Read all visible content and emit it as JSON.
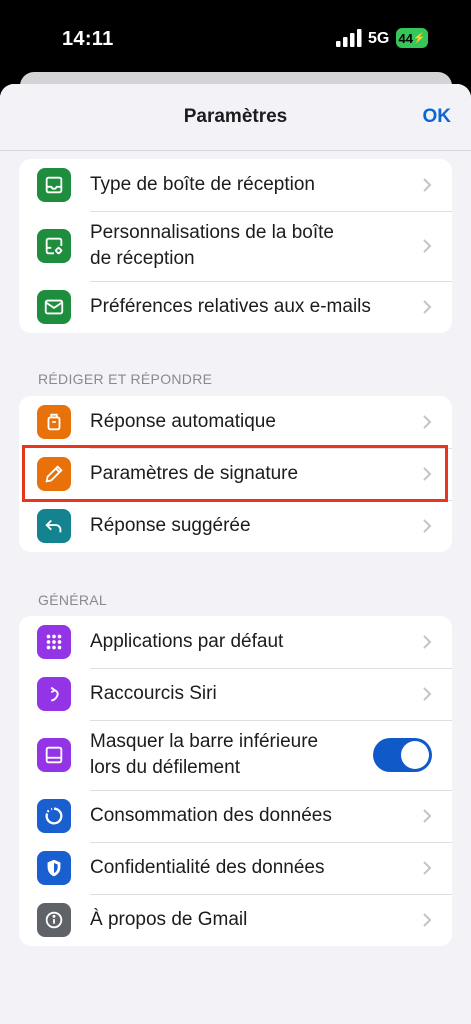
{
  "status": {
    "time": "14:11",
    "network": "5G",
    "battery": "44"
  },
  "header": {
    "title": "Paramètres",
    "ok_label": "OK"
  },
  "inbox_group": {
    "items": [
      {
        "label": "Type de boîte de réception",
        "icon": "inbox-icon",
        "color": "#1e8e3e"
      },
      {
        "label_line1": "Personnalisations de la boîte",
        "label_line2": "de réception",
        "icon": "inbox-settings-icon",
        "color": "#1e8e3e"
      },
      {
        "label": "Préférences relatives aux e-mails",
        "icon": "mail-icon",
        "color": "#1e8e3e"
      }
    ]
  },
  "compose_section": {
    "header": "RÉDIGER ET RÉPONDRE",
    "items": [
      {
        "label": "Réponse automatique",
        "icon": "suitcase-icon",
        "color": "#e8710a"
      },
      {
        "label": "Paramètres de signature",
        "icon": "pen-icon",
        "color": "#e8710a"
      },
      {
        "label": "Réponse suggérée",
        "icon": "reply-icon",
        "color": "#12838f"
      }
    ]
  },
  "general_section": {
    "header": "GÉNÉRAL",
    "items": [
      {
        "label": "Applications par défaut",
        "icon": "apps-grid-icon",
        "color": "#9334e6"
      },
      {
        "label": "Raccourcis Siri",
        "icon": "siri-shortcut-icon",
        "color": "#9334e6"
      },
      {
        "label_line1": "Masquer la barre inférieure",
        "label_line2": "lors du défilement",
        "icon": "bottom-bar-icon",
        "color": "#9334e6",
        "toggle_on": true
      },
      {
        "label": "Consommation des données",
        "icon": "data-usage-icon",
        "color": "#1a5fd0"
      },
      {
        "label": "Confidentialité des données",
        "icon": "shield-icon",
        "color": "#1a5fd0"
      },
      {
        "label": "À propos de Gmail",
        "icon": "info-icon",
        "color": "#5f6368"
      }
    ]
  }
}
